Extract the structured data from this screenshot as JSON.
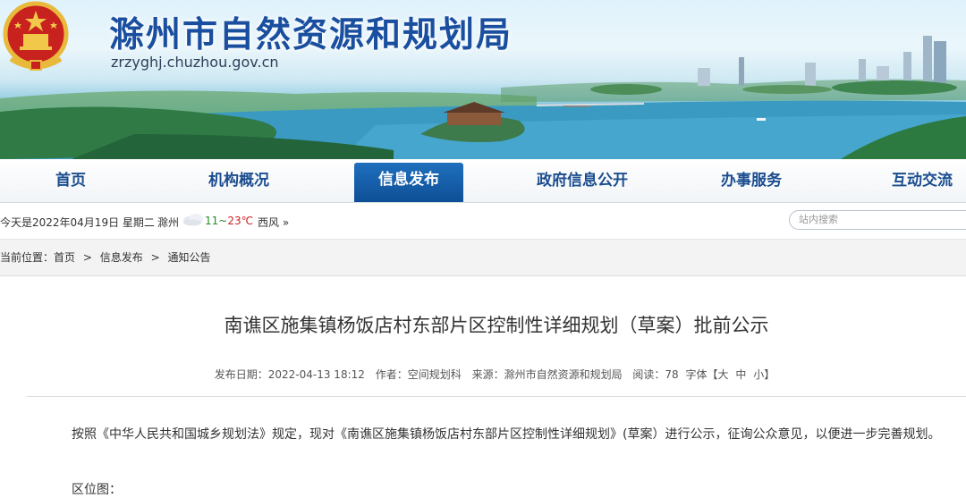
{
  "site": {
    "title": "滁州市自然资源和规划局",
    "domain": "zrzyghj.chuzhou.gov.cn"
  },
  "nav": {
    "items": [
      "首页",
      "机构概况",
      "信息发布",
      "政府信息公开",
      "办事服务",
      "互动交流"
    ],
    "active": "信息发布"
  },
  "infobar": {
    "date": "今天是2022年04月19日 星期二",
    "city": "滁州",
    "temp_low": "11",
    "temp_sep": "~",
    "temp_high": "23℃",
    "wind": "西风 »",
    "search_placeholder": "站内搜索"
  },
  "breadcrumb": {
    "prefix": "当前位置：",
    "items": [
      "首页",
      "信息发布",
      "通知公告"
    ],
    "sep": ">"
  },
  "article": {
    "title": "南谯区施集镇杨饭店村东部片区控制性详细规划（草案）批前公示",
    "meta": {
      "date": "发布日期：2022-04-13 18:12",
      "author": "作者：空间规划科",
      "source": "来源：滁州市自然资源和规划局",
      "reads": "阅读：78",
      "font_label": "字体【",
      "font_large": "大",
      "font_medium": "中",
      "font_small": "小",
      "font_close": "】"
    },
    "paragraph": "按照《中华人民共和国城乡规划法》规定，现对《南谯区施集镇杨饭店村东部片区控制性详细规划》(草案）进行公示，征询公众意见，以便进一步完善规划。",
    "next_line": "区位图："
  },
  "colors": {
    "brand_blue": "#1a4fa0",
    "nav_active": "#0e4f96"
  },
  "icons": [
    "national-emblem-icon",
    "cloudy-weather-icon"
  ]
}
